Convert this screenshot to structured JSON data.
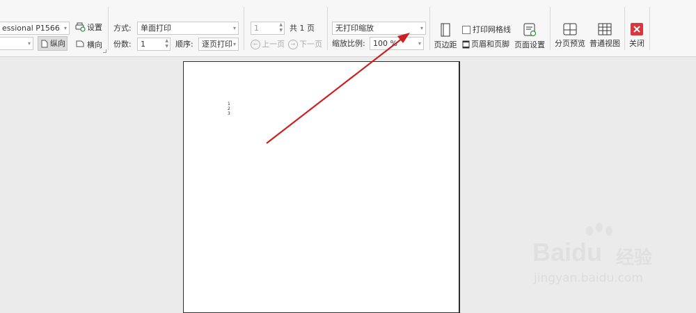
{
  "printer": {
    "name": "essional P1566",
    "second_value": "",
    "settings_label": "设置",
    "portrait_label": "纵向",
    "landscape_label": "横向"
  },
  "print_options": {
    "mode_label": "方式:",
    "mode_value": "单面打印",
    "copies_label": "份数:",
    "copies_value": "1",
    "order_label": "顺序:",
    "order_value": "逐页打印"
  },
  "pager": {
    "page_value": "1",
    "total_text": "共 1 页",
    "prev_label": "上一页",
    "next_label": "下一页"
  },
  "scaling": {
    "mode_value": "无打印缩放",
    "ratio_label": "缩放比例:",
    "ratio_value": "100 %"
  },
  "layout_buttons": {
    "margins_label": "页边距",
    "gridlines_label": "打印网格线",
    "gridlines_checked": false,
    "header_footer_label": "页眉和页脚",
    "page_setup_label": "页面设置"
  },
  "view_buttons": {
    "page_break_label": "分页预览",
    "normal_view_label": "普通视图",
    "close_label": "关闭"
  },
  "preview": {
    "cell_values": [
      "1",
      "2",
      "3"
    ]
  },
  "watermark": {
    "brand": "Baidu",
    "brand_cn": "经验",
    "url": "jingyan.baidu.com"
  },
  "colors": {
    "arrow": "#cc1f1f",
    "close_button": "#d9363e",
    "toolbar_bg": "#f7f7f7",
    "workspace_bg": "#ebebeb"
  }
}
